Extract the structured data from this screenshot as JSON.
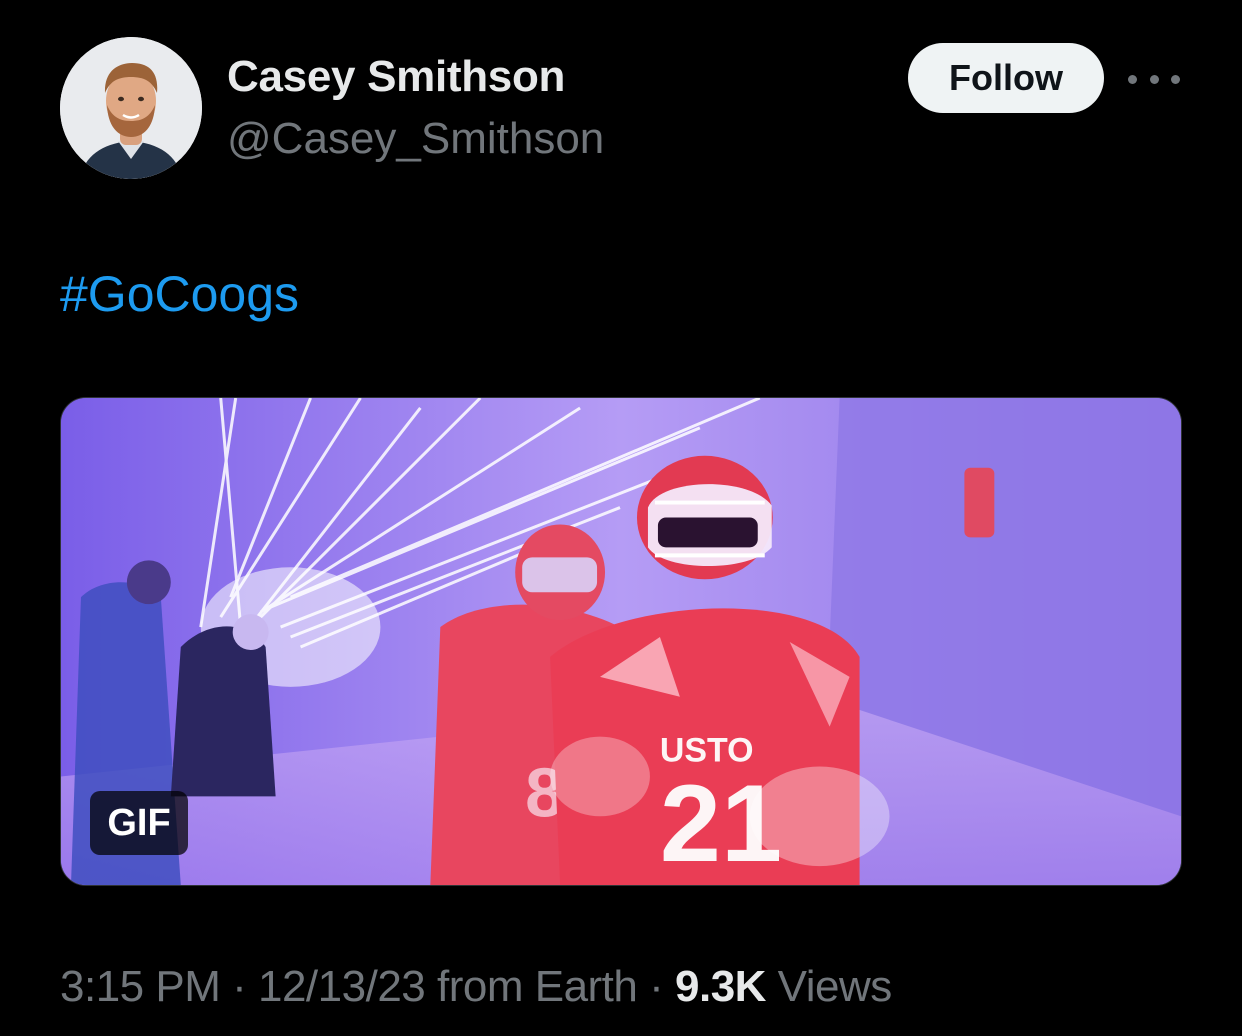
{
  "author": {
    "display_name": "Casey Smithson",
    "handle": "@Casey_Smithson",
    "avatar_icon": "profile-photo"
  },
  "actions": {
    "follow_label": "Follow",
    "more_icon": "more-dots-icon"
  },
  "tweet": {
    "hashtag": "#GoCoogs"
  },
  "media": {
    "type_badge": "GIF",
    "jersey_text_primary": "USTO",
    "jersey_number_primary": "21",
    "jersey_number_secondary": "8"
  },
  "meta": {
    "time": "3:15 PM",
    "separator1": " · ",
    "date": "12/13/23",
    "source": " from Earth",
    "separator2": " · ",
    "views_count": "9.3K",
    "views_label": " Views"
  },
  "colors": {
    "background": "#000000",
    "link": "#1d9bf0",
    "secondary_text": "#71767b",
    "primary_text": "#e7e9ea"
  }
}
